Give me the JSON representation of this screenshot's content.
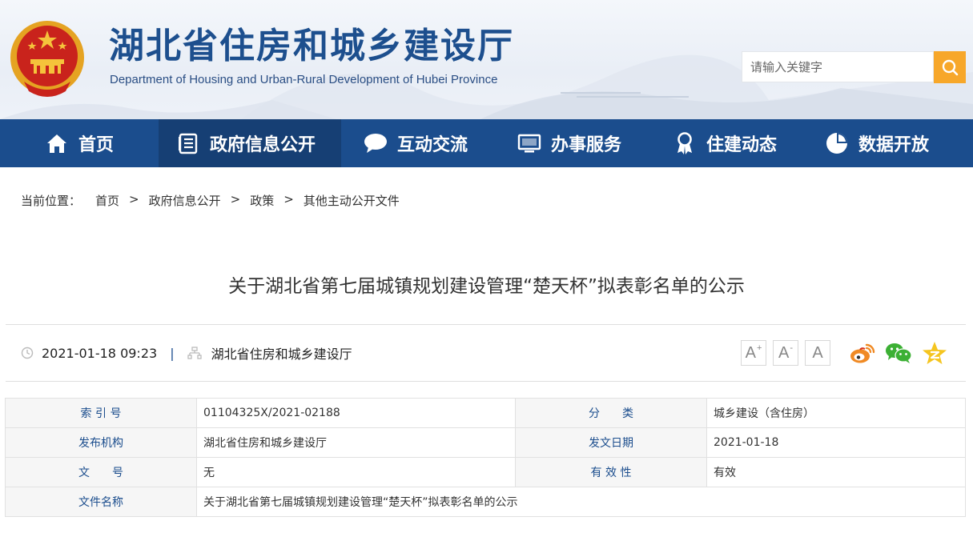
{
  "site": {
    "title": "湖北省住房和城乡建设厅",
    "subtitle": "Department of Housing and Urban-Rural Development of Hubei Province"
  },
  "search": {
    "placeholder": "请输入关键字"
  },
  "nav": [
    {
      "label": "首页",
      "icon": "home-icon"
    },
    {
      "label": "政府信息公开",
      "icon": "document-icon"
    },
    {
      "label": "互动交流",
      "icon": "chat-bubble-icon"
    },
    {
      "label": "办事服务",
      "icon": "monitor-icon"
    },
    {
      "label": "住建动态",
      "icon": "award-icon"
    },
    {
      "label": "数据开放",
      "icon": "pie-chart-icon"
    }
  ],
  "breadcrumb": {
    "prefix": "当前位置：",
    "items": [
      "首页",
      "政府信息公开",
      "政策",
      "其他主动公开文件"
    ],
    "separator": ">"
  },
  "article": {
    "title": "关于湖北省第七届城镇规划建设管理“楚天杯”拟表彰名单的公示",
    "datetime": "2021-01-18 09:23",
    "divider": "|",
    "publisher": "湖北省住房和城乡建设厅"
  },
  "font_size": {
    "larger": "A",
    "smaller": "A",
    "reset": "A",
    "larger_mark": "+",
    "smaller_mark": "-"
  },
  "info_table": {
    "row1": {
      "k1": "索 引 号",
      "v1": "01104325X/2021-02188",
      "k2": "分　　类",
      "v2": "城乡建设（含住房）"
    },
    "row2": {
      "k1": "发布机构",
      "v1": "湖北省住房和城乡建设厅",
      "k2": "发文日期",
      "v2": "2021-01-18"
    },
    "row3": {
      "k1": "文　　号",
      "v1": "无",
      "k2": "有 效 性",
      "v2": "有效"
    },
    "row4": {
      "k1": "文件名称",
      "v1": "关于湖北省第七届城镇规划建设管理“楚天杯”拟表彰名单的公示"
    }
  },
  "colors": {
    "nav_bg": "#1b4d8d",
    "nav_active": "#163f74",
    "search_button": "#f7a72a",
    "title_blue": "#1d4f8e"
  }
}
